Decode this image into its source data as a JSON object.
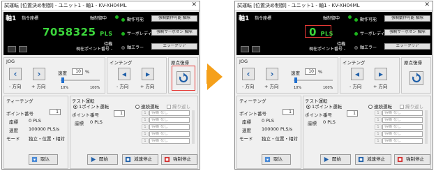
{
  "windows": [
    {
      "title": "試運転 [位置決め制御] - ユニット1 - 軸1 - KV-XH04ML",
      "axis": "軸1",
      "command_label": "指令座標",
      "command_value": "7058325",
      "command_unit": "PLS",
      "control_state": "軸制御中",
      "standby": "待機",
      "current_point": "現在ポイント番号 -",
      "status_rows": [
        {
          "label": "動作可能",
          "button": "強制動作可能 解除",
          "on": true
        },
        {
          "label": "サーボレディ",
          "button": "強制サーボオン 解除",
          "on": true
        },
        {
          "label": "軸エラー",
          "button": "エラークリア",
          "on": false
        }
      ],
      "jog": {
        "title": "JOG",
        "speed_label": "速度",
        "speed_value": "10",
        "speed_unit": "%",
        "minus_label": "- 方向",
        "plus_label": "+ 方向",
        "slider_min": "10%",
        "slider_max": "100%"
      },
      "inching": {
        "title": "インチング",
        "minus_label": "- 方向",
        "plus_label": "+ 方向"
      },
      "home": {
        "title": "原点復帰",
        "highlighted": true
      },
      "teaching": {
        "title": "ティーチング",
        "point_label": "ポイント番号",
        "point_value": "1",
        "coord_label": "座標",
        "coord_value": "0 PLS",
        "speed_label": "速度",
        "speed_value": "100000 PLS/s",
        "mode_label": "モード",
        "mode_value": "独立・位置・相対",
        "import_button": "取込"
      },
      "test": {
        "title": "テスト運転",
        "single": "1ポイント運転",
        "continuous": "連続運転",
        "repeat": "繰り返し",
        "point_label": "ポイント番号",
        "point_value": "1",
        "coord_label": "座標",
        "coord_value": "0 PLS",
        "rows": [
          "待機 なし",
          "待機 なし",
          "待機 なし",
          "待機 なし",
          "待機 なし"
        ],
        "start": "開始",
        "decel_stop": "減速停止",
        "forced_stop": "強制停止"
      }
    },
    {
      "title": "試運転 [位置決め制御] - ユニット1 - 軸1 - KV-XH04ML",
      "axis": "軸1",
      "command_label": "指令座標",
      "command_value": "0",
      "command_unit": "PLS",
      "control_state": "軸制御中",
      "standby": "待機",
      "current_point": "現在ポイント番号 -",
      "status_rows": [
        {
          "label": "動作可能",
          "button": "強制動作可能 解除",
          "on": true
        },
        {
          "label": "サーボレディ",
          "button": "強制サーボオン 解除",
          "on": true
        },
        {
          "label": "軸エラー",
          "button": "エラークリア",
          "on": false
        }
      ],
      "jog": {
        "title": "JOG",
        "speed_label": "速度",
        "speed_value": "10",
        "speed_unit": "%",
        "minus_label": "- 方向",
        "plus_label": "+ 方向",
        "slider_min": "10%",
        "slider_max": "100%"
      },
      "inching": {
        "title": "インチング",
        "minus_label": "- 方向",
        "plus_label": "+ 方向"
      },
      "home": {
        "title": "原点復帰",
        "highlighted": false
      },
      "teaching": {
        "title": "ティーチング",
        "point_label": "ポイント番号",
        "point_value": "1",
        "coord_label": "座標",
        "coord_value": "0 PLS",
        "speed_label": "速度",
        "speed_value": "100000 PLS/s",
        "mode_label": "モード",
        "mode_value": "独立・位置・相対",
        "import_button": "取込"
      },
      "test": {
        "title": "テスト運転",
        "single": "1ポイント運転",
        "continuous": "連続運転",
        "repeat": "繰り返し",
        "point_label": "ポイント番号",
        "point_value": "1",
        "coord_label": "座標",
        "coord_value": "0 PLS",
        "rows": [
          "待機 なし",
          "待機 なし",
          "待機 なし",
          "待機 なし",
          "待機 なし"
        ],
        "start": "開始",
        "decel_stop": "減速停止",
        "forced_stop": "強制停止"
      }
    }
  ],
  "colors": {
    "accent_green": "#3cd73c",
    "highlight_red": "#e53935",
    "arrow_orange": "#f5a01a"
  },
  "icons": [
    "close-icon",
    "chevron-left-icon",
    "chevron-right-icon",
    "step-left-icon",
    "step-right-icon",
    "home-return-icon",
    "import-icon",
    "play-icon",
    "decel-stop-icon",
    "forced-stop-icon"
  ]
}
